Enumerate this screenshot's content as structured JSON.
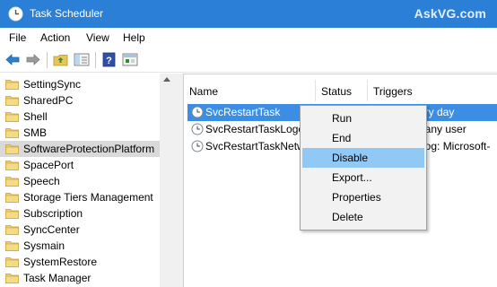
{
  "window": {
    "title": "Task Scheduler",
    "watermark": "AskVG.com",
    "accent_color": "#2b7fd6"
  },
  "menubar": {
    "items": [
      "File",
      "Action",
      "View",
      "Help"
    ]
  },
  "toolbar": {
    "icons": [
      "back-arrow-icon",
      "forward-arrow-icon",
      "folder-up-icon",
      "show-hide-tree-icon",
      "help-icon",
      "properties-icon"
    ]
  },
  "tree": {
    "items": [
      {
        "label": "SettingSync",
        "selected": false
      },
      {
        "label": "SharedPC",
        "selected": false
      },
      {
        "label": "Shell",
        "selected": false
      },
      {
        "label": "SMB",
        "selected": false
      },
      {
        "label": "SoftwareProtectionPlatform",
        "selected": true
      },
      {
        "label": "SpacePort",
        "selected": false
      },
      {
        "label": "Speech",
        "selected": false
      },
      {
        "label": "Storage Tiers Management",
        "selected": false
      },
      {
        "label": "Subscription",
        "selected": false
      },
      {
        "label": "SyncCenter",
        "selected": false
      },
      {
        "label": "Sysmain",
        "selected": false
      },
      {
        "label": "SystemRestore",
        "selected": false
      },
      {
        "label": "Task Manager",
        "selected": false
      }
    ]
  },
  "list": {
    "columns": [
      "Name",
      "Status",
      "Triggers"
    ],
    "rows": [
      {
        "name": "SvcRestartTask",
        "trigger": "ery day",
        "selected": true
      },
      {
        "name": "SvcRestartTaskLogon",
        "trigger": "f any user",
        "selected": false
      },
      {
        "name": "SvcRestartTaskNetw",
        "trigger": "Log: Microsoft-",
        "selected": false
      }
    ]
  },
  "context_menu": {
    "items": [
      "Run",
      "End",
      "Disable",
      "Export...",
      "Properties",
      "Delete"
    ],
    "highlighted": "Disable"
  }
}
